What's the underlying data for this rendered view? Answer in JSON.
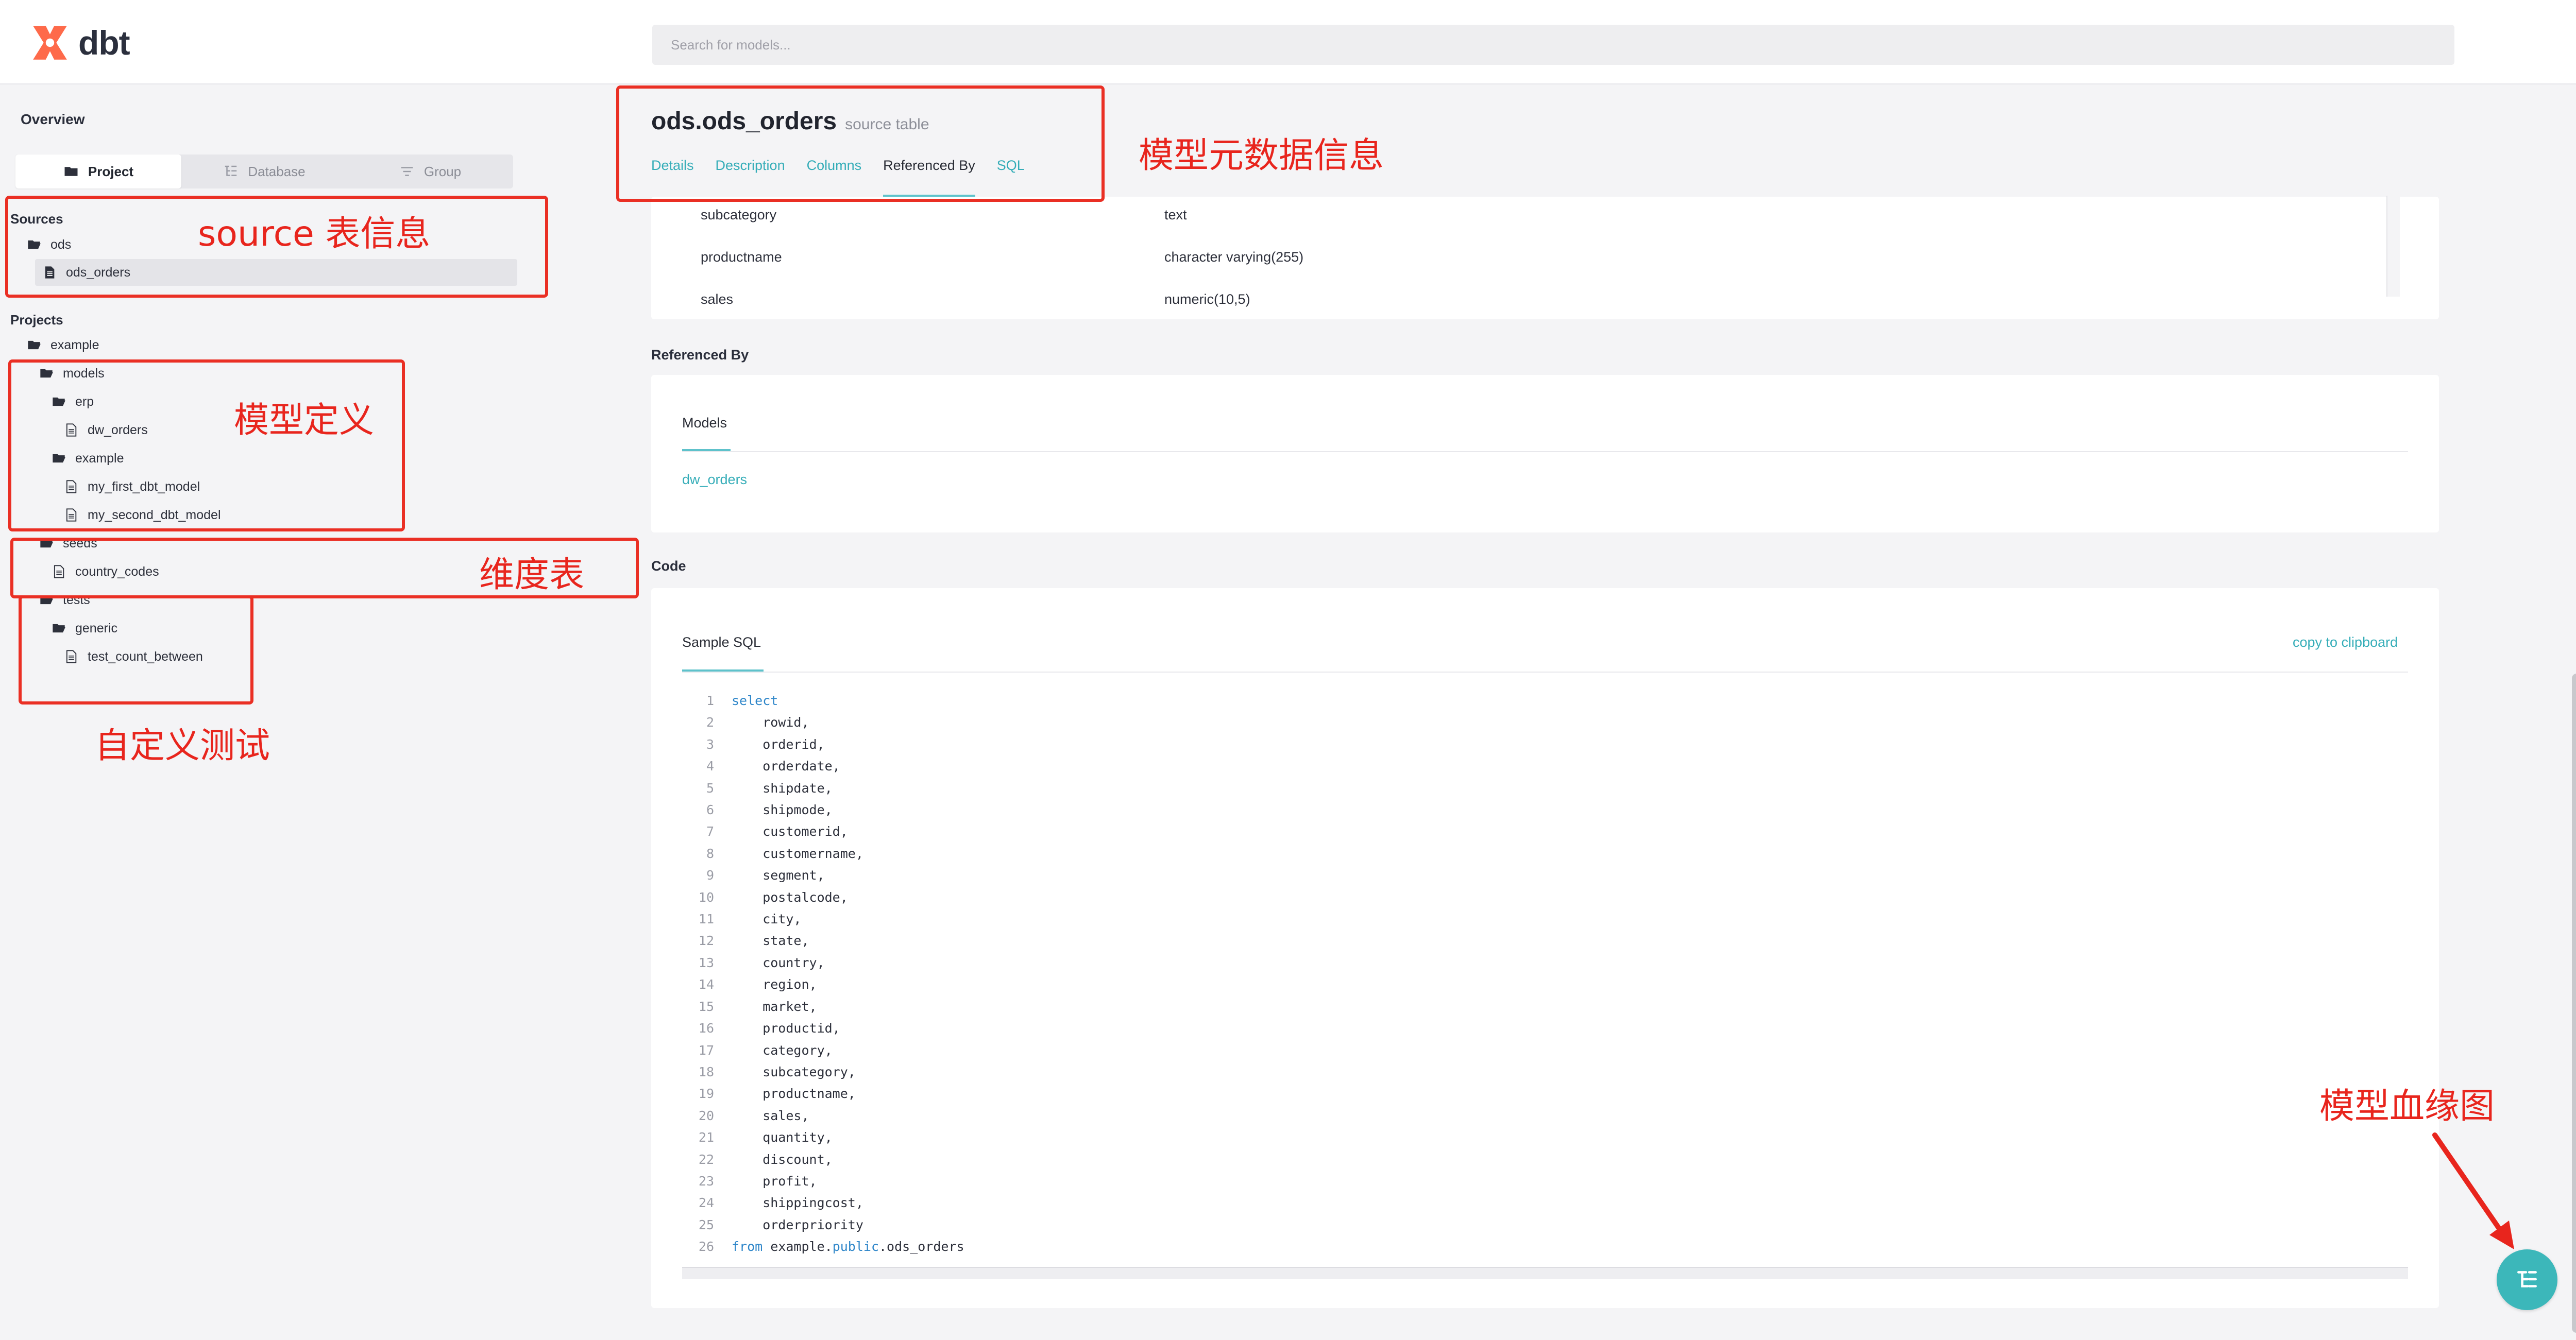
{
  "header": {
    "logo_text": "dbt",
    "search_placeholder": "Search for models..."
  },
  "sidebar": {
    "overview": "Overview",
    "tabs": [
      {
        "label": "Project",
        "icon": "folder-icon",
        "active": true
      },
      {
        "label": "Database",
        "icon": "database-tree-icon",
        "active": false
      },
      {
        "label": "Group",
        "icon": "filter-lines-icon",
        "active": false
      }
    ],
    "sources_heading": "Sources",
    "sources": {
      "folder": "ods",
      "item": "ods_orders"
    },
    "projects_heading": "Projects",
    "project": {
      "name": "example",
      "models": "models",
      "erp": "erp",
      "dw_orders": "dw_orders",
      "example": "example",
      "my_first_dbt_model": "my_first_dbt_model",
      "my_second_dbt_model": "my_second_dbt_model",
      "seeds": "seeds",
      "country_codes": "country_codes",
      "tests": "tests",
      "generic": "generic",
      "test_count_between": "test_count_between"
    }
  },
  "main": {
    "title": "ods.ods_orders",
    "subtitle": "source table",
    "tabs": [
      "Details",
      "Description",
      "Columns",
      "Referenced By",
      "SQL"
    ],
    "active_tab": "Referenced By",
    "columns": [
      {
        "name": "subcategory",
        "type": "text"
      },
      {
        "name": "productname",
        "type": "character varying(255)"
      },
      {
        "name": "sales",
        "type": "numeric(10,5)"
      }
    ],
    "referenced_by": {
      "heading": "Referenced By",
      "tab": "Models",
      "items": [
        "dw_orders"
      ]
    },
    "code": {
      "heading": "Code",
      "tab": "Sample SQL",
      "copy": "copy to clipboard",
      "lines": [
        "select",
        "    rowid,",
        "    orderid,",
        "    orderdate,",
        "    shipdate,",
        "    shipmode,",
        "    customerid,",
        "    customername,",
        "    segment,",
        "    postalcode,",
        "    city,",
        "    state,",
        "    country,",
        "    region,",
        "    market,",
        "    productid,",
        "    category,",
        "    subcategory,",
        "    productname,",
        "    sales,",
        "    quantity,",
        "    discount,",
        "    profit,",
        "    shippingcost,",
        "    orderpriority",
        "from example.public.ods_orders"
      ]
    }
  },
  "annotations": {
    "source": "source 表信息",
    "model_def": "模型定义",
    "dimension": "维度表",
    "custom_test": "自定义测试",
    "metadata": "模型元数据信息",
    "lineage": "模型血缘图"
  },
  "colors": {
    "accent": "#35adb8",
    "annotation": "#e8251d",
    "logo": "#fe6a4a"
  }
}
